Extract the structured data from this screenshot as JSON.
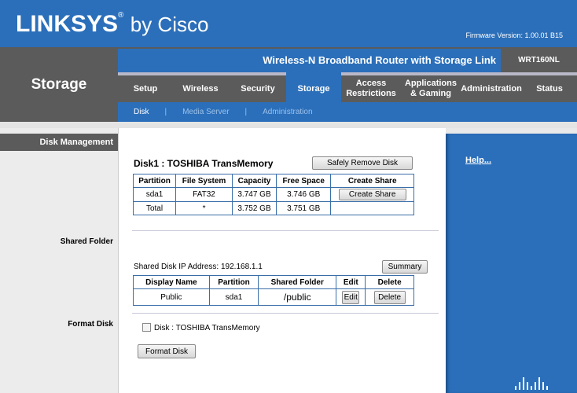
{
  "header": {
    "logo_brand": "LINKSYS",
    "logo_reg": "®",
    "logo_by": "by Cisco",
    "firmware": "Firmware Version: 1.00.01 B15"
  },
  "section_title": "Storage",
  "product_name": "Wireless-N Broadband Router with Storage Link",
  "model": "WRT160NL",
  "tabs": [
    {
      "label": "Setup"
    },
    {
      "label": "Wireless"
    },
    {
      "label": "Security"
    },
    {
      "label": "Storage",
      "active": true
    },
    {
      "label": "Access Restrictions"
    },
    {
      "label": "Applications & Gaming"
    },
    {
      "label": "Administration"
    },
    {
      "label": "Status"
    }
  ],
  "subnav": [
    {
      "label": "Disk",
      "active": true
    },
    {
      "label": "|"
    },
    {
      "label": "Media Server"
    },
    {
      "label": "|"
    },
    {
      "label": "Administration"
    }
  ],
  "sidebar": {
    "disk_management": "Disk Management",
    "shared_folder": "Shared Folder",
    "format_disk": "Format Disk"
  },
  "disk": {
    "title": "Disk1 : TOSHIBA TransMemory",
    "safely_remove": "Safely Remove Disk",
    "columns": [
      "Partition",
      "File System",
      "Capacity",
      "Free Space",
      "Create Share"
    ],
    "rows": [
      [
        "sda1",
        "FAT32",
        "3.747 GB",
        "3.746 GB",
        "Create Share"
      ],
      [
        "Total",
        "*",
        "3.752 GB",
        "3.751 GB",
        ""
      ]
    ]
  },
  "shared": {
    "ip_label": "Shared Disk IP Address: 192.168.1.1",
    "summary": "Summary",
    "columns": [
      "Display Name",
      "Partition",
      "Shared Folder",
      "Edit",
      "Delete"
    ],
    "rows": [
      [
        "Public",
        "sda1",
        "/public",
        "Edit",
        "Delete"
      ]
    ]
  },
  "format": {
    "checkbox_label": "Disk : TOSHIBA TransMemory",
    "checked": false,
    "button": "Format Disk"
  },
  "help": "Help...",
  "colors": {
    "brand_blue": "#2b6fba",
    "dark_gray": "#5b5b5b"
  }
}
